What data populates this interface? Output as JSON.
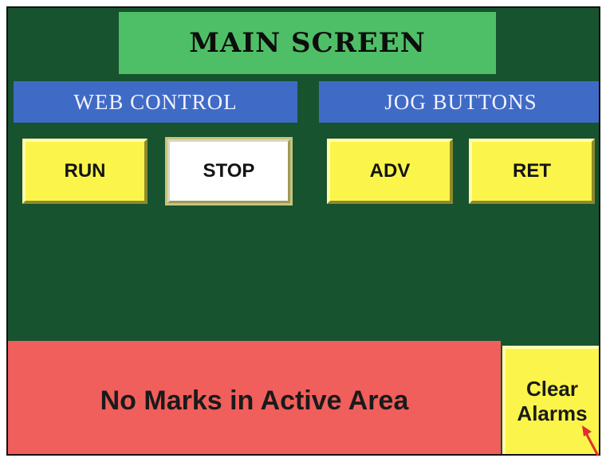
{
  "title": "MAIN SCREEN",
  "sections": {
    "web_control": "WEB CONTROL",
    "jog_buttons": "JOG BUTTONS"
  },
  "buttons": {
    "run": "RUN",
    "stop": "STOP",
    "adv": "ADV",
    "ret": "RET"
  },
  "alarm": {
    "message": "No Marks in Active Area",
    "clear_line1": "Clear",
    "clear_line2": "Alarms"
  },
  "colors": {
    "background": "#17532f",
    "title_bg": "#4fbf67",
    "section_bg": "#3f6bc6",
    "button_yellow": "#fbf54b",
    "button_active_white": "#ffffff",
    "alarm_red": "#f05f5c",
    "annotation_arrow": "#e0302a"
  }
}
